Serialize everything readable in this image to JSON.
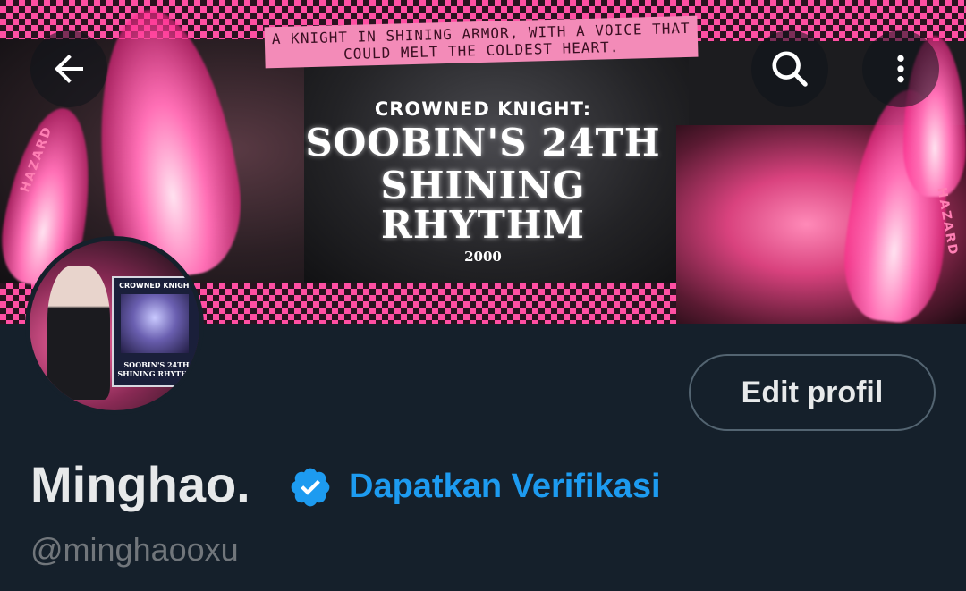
{
  "banner": {
    "quote": "A KNIGHT IN SHINING ARMOR, WITH A VOICE THAT COULD MELT THE COLDEST HEART.",
    "subtitle": "CROWNED KNIGHT:",
    "title_line1": "SOOBIN'S 24TH",
    "title_line2": "SHINING RHYTHM",
    "year": "2000",
    "hazard_left": "HAZARD",
    "hazard_right": "HAZARD"
  },
  "nav": {
    "back_icon": "arrow-left-icon",
    "search_icon": "search-icon",
    "more_icon": "more-vertical-icon"
  },
  "avatar": {
    "card_title": "CROWNED KNIGHT",
    "card_text_line1": "SOOBIN'S 24TH",
    "card_text_line2": "SHINING RHYTHM"
  },
  "profile": {
    "edit_label": "Edit profil",
    "display_name": "Minghao.",
    "verify_label": "Dapatkan Verifikasi",
    "handle": "@minghaooxu"
  },
  "colors": {
    "background": "#15202b",
    "accent": "#1d9bf0",
    "banner_pink": "#ff4fa3",
    "muted_text": "#71767b"
  }
}
